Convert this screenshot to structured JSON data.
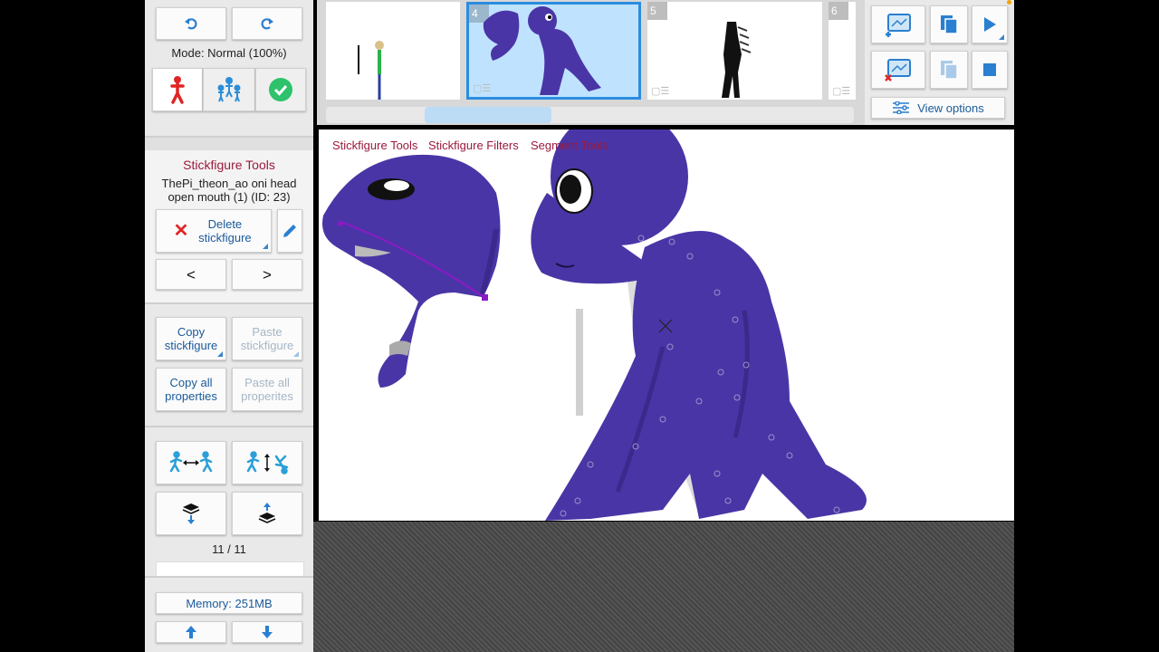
{
  "left_panel": {
    "mode_label": "Mode: Normal (100%)",
    "section_title": "Stickfigure Tools",
    "figure_name": "ThePi_theon_ao oni head open mouth (1) (ID: 23)",
    "delete_label": "Delete stickfigure",
    "prev_label": "<",
    "next_label": ">",
    "copy_label": "Copy stickfigure",
    "paste_label": "Paste stickfigure",
    "copy_all_label": "Copy all properties",
    "paste_all_label": "Paste all properites",
    "layer_count": "11 / 11",
    "memory_label": "Memory: 251MB"
  },
  "timeline": {
    "frames": [
      {
        "number": ""
      },
      {
        "number": "4"
      },
      {
        "number": "5"
      },
      {
        "number": "6"
      }
    ]
  },
  "toolbar": {
    "view_options_label": "View options"
  },
  "canvas_menu": {
    "items": [
      "Stickfigure Tools",
      "Stickfigure Filters",
      "Segment Tools"
    ]
  },
  "colors": {
    "accent_blue": "#1a5a9a",
    "menu_red": "#9a1a3c",
    "figure_purple": "#4a35a6",
    "selected_frame": "#2b8de0"
  }
}
